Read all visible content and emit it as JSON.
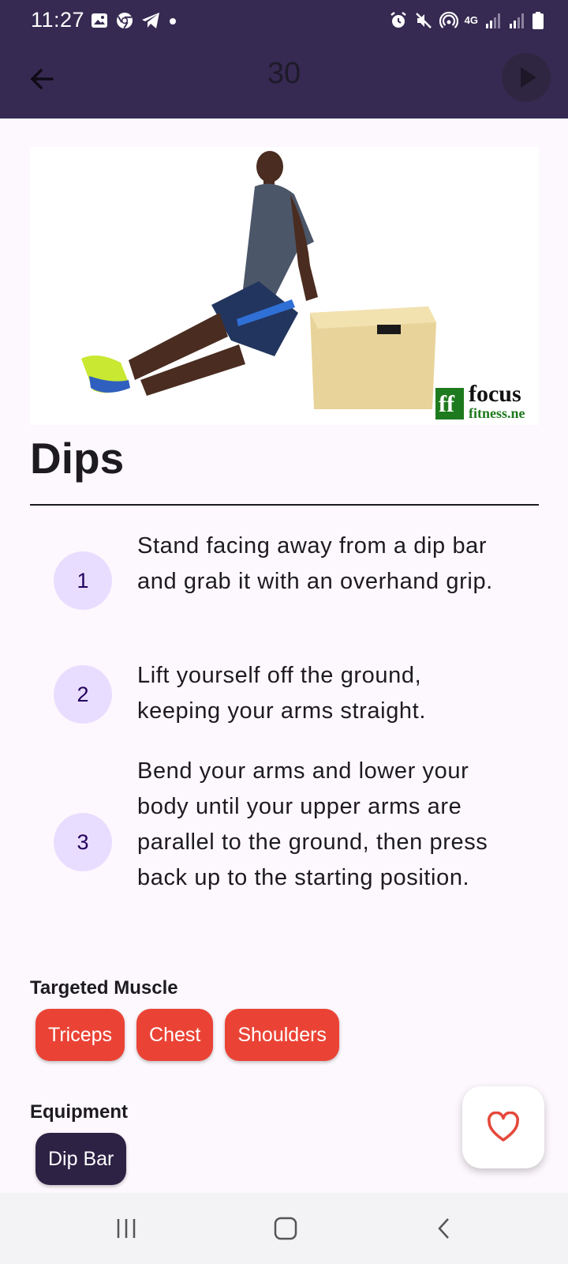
{
  "status_bar": {
    "time": "11:27",
    "left_icons": [
      "gallery-icon",
      "chrome-icon",
      "telegram-icon",
      "dot-icon"
    ],
    "right_icons": [
      "alarm-icon",
      "mute-icon",
      "hotspot-icon",
      "4g-icon",
      "signal-icon",
      "signal-icon",
      "battery-icon"
    ],
    "network_label": "4G"
  },
  "app_bar": {
    "title": "30",
    "back_icon": "arrow-left-icon",
    "play_icon": "play-icon",
    "background_color": "#362a52"
  },
  "hero": {
    "watermark_brand": "focus",
    "watermark_domain": "fitness.ne"
  },
  "exercise": {
    "name": "Dips",
    "steps": [
      {
        "number": "1",
        "text": "Stand facing away from a dip bar and grab it with an overhand grip."
      },
      {
        "number": "2",
        "text": "Lift yourself off the ground, keeping your arms straight."
      },
      {
        "number": "3",
        "text": "Bend your arms and lower your body until your upper arms are parallel to the ground, then press back up to the starting position."
      }
    ]
  },
  "targeted_muscle": {
    "label": "Targeted Muscle",
    "chips": [
      "Triceps",
      "Chest",
      "Shoulders"
    ],
    "chip_color": "#ea4335"
  },
  "equipment": {
    "label": "Equipment",
    "chips": [
      "Dip Bar"
    ],
    "chip_color": "#2d2244"
  },
  "favorite": {
    "icon": "heart-icon",
    "color": "#e5483b"
  },
  "nav_bar": {
    "icons": [
      "recents-icon",
      "home-icon",
      "back-icon"
    ]
  }
}
